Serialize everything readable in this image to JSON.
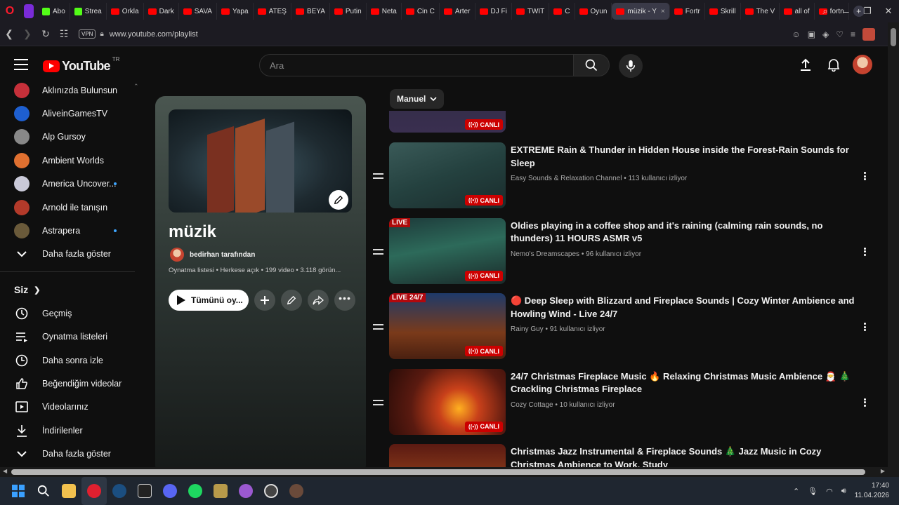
{
  "browser": {
    "tabs": [
      {
        "label": "Abo",
        "fav": "green"
      },
      {
        "label": "Strea",
        "fav": "green"
      },
      {
        "label": "Orkla",
        "fav": "yt"
      },
      {
        "label": "Dark",
        "fav": "yt"
      },
      {
        "label": "SAVA",
        "fav": "yt"
      },
      {
        "label": "Yapa",
        "fav": "yt"
      },
      {
        "label": "ATEŞ",
        "fav": "yt"
      },
      {
        "label": "BEYA",
        "fav": "yt"
      },
      {
        "label": "Putin",
        "fav": "yt"
      },
      {
        "label": "Neta",
        "fav": "yt"
      },
      {
        "label": "Cin C",
        "fav": "yt"
      },
      {
        "label": "Arter",
        "fav": "yt"
      },
      {
        "label": "DJ Fi",
        "fav": "yt"
      },
      {
        "label": "TWIT",
        "fav": "yt"
      },
      {
        "label": "C",
        "fav": "yt"
      },
      {
        "label": "Oyun",
        "fav": "yt"
      },
      {
        "label": "müzik - Y",
        "fav": "yt",
        "active": true
      },
      {
        "label": "Fortr",
        "fav": "yt"
      },
      {
        "label": "Skrill",
        "fav": "yt"
      },
      {
        "label": "The V",
        "fav": "yt"
      },
      {
        "label": "all of",
        "fav": "yt"
      },
      {
        "label": "fortn",
        "fav": "yt"
      }
    ],
    "vpn_label": "VPN",
    "url": "www.youtube.com/playlist"
  },
  "header": {
    "logo_text": "YouTube",
    "region": "TR",
    "search_placeholder": "Ara"
  },
  "sidebar": {
    "subscriptions": [
      {
        "label": "Aklınızda Bulunsun",
        "color": "#c6303a",
        "dot": false
      },
      {
        "label": "AliveinGamesTV",
        "color": "#1e5fd0",
        "dot": false
      },
      {
        "label": "Alp Gursoy",
        "color": "#888888",
        "dot": false
      },
      {
        "label": "Ambient Worlds",
        "color": "#e07030",
        "dot": false
      },
      {
        "label": "America Uncover...",
        "color": "#c9c9d8",
        "dot": true
      },
      {
        "label": "Arnold ile tanışın",
        "color": "#b33a2a",
        "dot": false
      },
      {
        "label": "Astrapera",
        "color": "#6a5a3a",
        "dot": true
      }
    ],
    "show_more": "Daha fazla göster",
    "you_heading": "Siz",
    "you_items": [
      {
        "label": "Geçmiş",
        "icon": "history-icon"
      },
      {
        "label": "Oynatma listeleri",
        "icon": "playlists-icon"
      },
      {
        "label": "Daha sonra izle",
        "icon": "watch-later-icon"
      },
      {
        "label": "Beğendiğim videolar",
        "icon": "thumbs-up-icon"
      },
      {
        "label": "Videolarınız",
        "icon": "your-videos-icon"
      },
      {
        "label": "İndirilenler",
        "icon": "download-icon"
      }
    ],
    "show_more_2": "Daha fazla göster"
  },
  "playlist": {
    "title": "müzik",
    "owner": "bedirhan tarafından",
    "meta": "Oynatma listesi • Herkese açık • 199 video • 3.118 görün...",
    "play_all": "Tümünü oy..."
  },
  "sort": {
    "label": "Manuel"
  },
  "videos": [
    {
      "title": "",
      "channel": "",
      "viewers": "",
      "badge": "CANLI",
      "thumb": "linear-gradient(180deg,#2c2a40,#3a2f50)",
      "partial_top": true
    },
    {
      "title": "EXTREME Rain & Thunder in Hidden House inside the Forest-Rain Sounds for Sleep",
      "channel": "Easy Sounds & Relaxation Channel",
      "viewers": "113 kullanıcı izliyor",
      "badge": "CANLI",
      "thumb": "linear-gradient(160deg,#3a5a58 0%,#24413f 50%,#1a2c2c 100%)"
    },
    {
      "title": "Oldies playing in a coffee shop and it's raining (calming rain sounds, no thunders) 11 HOURS ASMR v5",
      "channel": "Nemo's Dreamscapes",
      "viewers": "96 kullanıcı izliyor",
      "badge": "CANLI",
      "corner": "LIVE",
      "thumb": "linear-gradient(170deg,#1d3a3a 0%,#2d6a5a 45%,#1a2a2a 100%)"
    },
    {
      "title": "🔴 Deep Sleep with Blizzard and Fireplace Sounds | Cozy Winter Ambience and Howling Wind - Live 24/7",
      "channel": "Rainy Guy",
      "viewers": "91 kullanıcı izliyor",
      "badge": "CANLI",
      "corner": "LIVE 24/7",
      "thumb": "linear-gradient(180deg,#1e3a6a 0%,#7a3a1a 60%,#4a2010 100%)"
    },
    {
      "title": "24/7 Christmas Fireplace Music 🔥 Relaxing Christmas Music Ambience 🎅 🎄 Crackling Christmas Fireplace",
      "channel": "Cozy Cottage",
      "viewers": "10 kullanıcı izliyor",
      "badge": "CANLI",
      "thumb": "radial-gradient(circle at 60% 60%,#ffb020 0%,#c8401a 25%,#5a1a10 60%,#2a0c08 100%)"
    },
    {
      "title": "Christmas Jazz Instrumental & Fireplace Sounds 🎄 Jazz Music in Cozy Christmas Ambience to Work, Study",
      "channel": "",
      "viewers": "",
      "badge": "",
      "thumb": "linear-gradient(180deg,#5a1a12 0%,#8a3a1a 50%,#3a120a 100%)"
    }
  ],
  "taskbar": {
    "time": "17:40",
    "date": "11.04.2026"
  }
}
